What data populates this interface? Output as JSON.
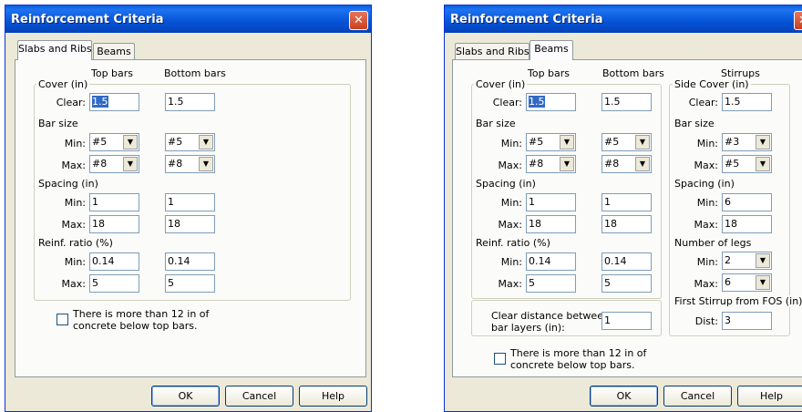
{
  "dialog": {
    "title": "Reinforcement Criteria",
    "close_glyph": "✕",
    "tabs": {
      "slabs": "Slabs and Ribs",
      "beams": "Beams"
    },
    "buttons": {
      "ok": "OK",
      "cancel": "Cancel",
      "help": "Help"
    },
    "dropdown_glyph": "▼"
  },
  "headers": {
    "top": "Top bars",
    "bottom": "Bottom bars",
    "stirrups": "Stirrups"
  },
  "groups": {
    "cover": "Cover (in)",
    "bar_size": "Bar size",
    "spacing": "Spacing (in)",
    "reinf_ratio": "Reinf. ratio (%)",
    "side_cover": "Side Cover (in)",
    "legs": "Number of legs",
    "first_stirrup": "First Stirrup from FOS (in)"
  },
  "labels": {
    "clear": "Clear:",
    "min": "Min:",
    "max": "Max:",
    "dist": "Dist:"
  },
  "values": {
    "cover": {
      "top": "1.5",
      "bottom": "1.5"
    },
    "bar_size": {
      "min_top": "#5",
      "min_bottom": "#5",
      "max_top": "#8",
      "max_bottom": "#8"
    },
    "spacing": {
      "min_top": "1",
      "min_bottom": "1",
      "max_top": "18",
      "max_bottom": "18"
    },
    "ratio": {
      "min_top": "0.14",
      "min_bottom": "0.14",
      "max_top": "5",
      "max_bottom": "5"
    }
  },
  "stirrups": {
    "side_cover": "1.5",
    "bar_min": "#3",
    "bar_max": "#5",
    "spacing_min": "6",
    "spacing_max": "18",
    "legs_min": "2",
    "legs_max": "6",
    "first_dist": "3"
  },
  "clear_distance": {
    "label_1": "Clear distance between",
    "label_2": "bar layers (in):",
    "value": "1"
  },
  "checkbox": {
    "line_1": "There is more than 12 in of",
    "line_2": "concrete below top bars.",
    "checked": false
  }
}
